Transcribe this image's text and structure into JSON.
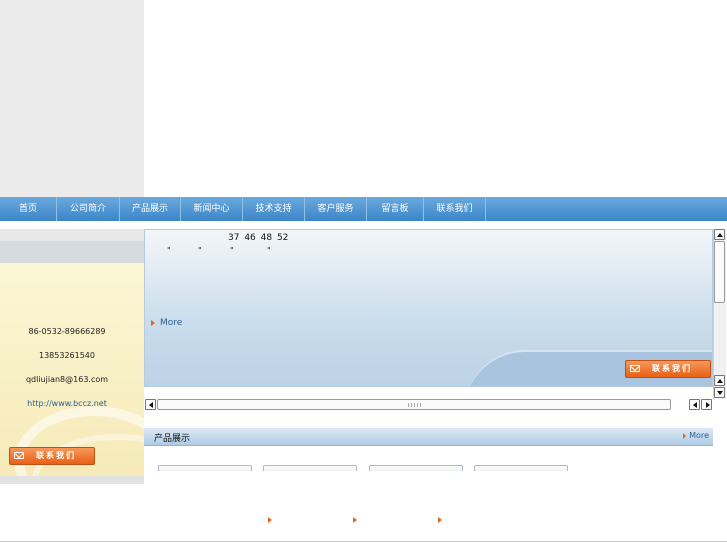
{
  "nav": {
    "items": [
      {
        "label": "首页"
      },
      {
        "label": "公司简介"
      },
      {
        "label": "产品展示"
      },
      {
        "label": "新闻中心"
      },
      {
        "label": "技术支持"
      },
      {
        "label": "客户服务"
      },
      {
        "label": "留言板"
      },
      {
        "label": "联系我们"
      }
    ]
  },
  "contact": {
    "phone": "86-0532-89666289",
    "mobile": "13853261540",
    "email": "qdliujian8@163.com",
    "website": "http://www.bccz.net",
    "button_label": "联系我们"
  },
  "main": {
    "numbers": "37 46 48 52",
    "quotes": [
      "\"",
      "\"",
      "\"",
      "\""
    ],
    "more_label": "More",
    "contact_button_label": "联系我们"
  },
  "section": {
    "title": "产品展示",
    "more_label": "More"
  },
  "colors": {
    "nav_bar": "#3c86c8",
    "accent_orange": "#e86015",
    "link_blue": "#2f5f8f",
    "panel_cream": "#f6eab9"
  }
}
